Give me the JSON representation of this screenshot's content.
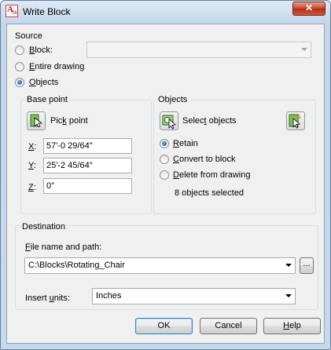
{
  "window": {
    "title": "Write Block",
    "close_glyph": "✕"
  },
  "source": {
    "title": "Source",
    "block_label": "Block:",
    "block_value": "",
    "entire_drawing_label": "Entire drawing",
    "objects_label": "Objects",
    "selected": "objects"
  },
  "base_point": {
    "title": "Base point",
    "pick_point_label": "Pick point",
    "x_label": "X:",
    "x_value": "57'-0 29/64\"",
    "y_label": "Y:",
    "y_value": "25'-2 45/64\"",
    "z_label": "Z:",
    "z_value": "0\""
  },
  "objects": {
    "title": "Objects",
    "select_objects_label": "Select objects",
    "retain_label": "Retain",
    "convert_label": "Convert to block",
    "delete_label": "Delete from drawing",
    "selected_option": "retain",
    "count_text": "8 objects selected"
  },
  "destination": {
    "title": "Destination",
    "file_label": "File name and path:",
    "file_value": "C:\\Blocks\\Rotating_Chair",
    "browse_label": "...",
    "units_label": "Insert units:",
    "units_value": "Inches"
  },
  "buttons": {
    "ok": "OK",
    "cancel": "Cancel",
    "help": "Help"
  },
  "icons": {
    "app": "autocad-icon",
    "pick_point": "pick-point-icon",
    "select_objects": "select-objects-icon",
    "quick_select": "quick-select-icon"
  }
}
